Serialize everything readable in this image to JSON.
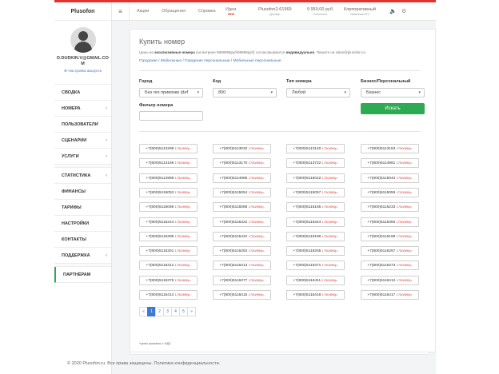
{
  "brand": "Plusofon",
  "user": {
    "email": "D.DUDKIN.V@GMAIL.COM",
    "account_link": "Настройка аккаунта"
  },
  "nav": [
    {
      "label": "СВОДКА",
      "chevron": false
    },
    {
      "label": "НОМЕРА",
      "chevron": true
    },
    {
      "label": "ПОЛЬЗОВАТЕЛИ",
      "chevron": false
    },
    {
      "label": "СЦЕНАРИИ",
      "chevron": true
    },
    {
      "label": "УСЛУГИ",
      "chevron": true
    },
    {
      "label": "СТАТИСТИКА",
      "chevron": true
    },
    {
      "label": "ФИНАНСЫ",
      "chevron": false
    },
    {
      "label": "ТАРИФЫ",
      "chevron": false
    },
    {
      "label": "НАСТРОЙКИ",
      "chevron": false
    },
    {
      "label": "КОНТАКТЫ",
      "chevron": false
    },
    {
      "label": "ПОДДЕРЖКА",
      "chevron": true
    },
    {
      "label": "ПАРТНЁРАМ",
      "chevron": false
    }
  ],
  "topbar": {
    "links": [
      "Акции",
      "Обращения",
      "Справка",
      "Идеи"
    ],
    "new_badge": "NEW",
    "account": {
      "value": "Plusofon2-61969",
      "sub": "Договор"
    },
    "balance": {
      "value": "9 959,00 руб.",
      "sub": "Пополнить"
    },
    "company": {
      "value": "Корпоративный",
      "sub": "Обменная АТС"
    },
    "icons": [
      "sound-icon",
      "settings-icon"
    ]
  },
  "panel": {
    "title": "Купить номер",
    "desc_pre": "Цены на ",
    "desc_bold1": "эксклюзивные номера",
    "desc_mid": " (на витрине 9999999руб/99999руб) согласовываются ",
    "desc_bold2": "индивидуально",
    "desc_post": ". Пишите на sales@plusofon.ru.",
    "crumbs": "Городские / Мобильные / Городские персональные / Мобильные персональные"
  },
  "filters": {
    "city_label": "Город",
    "city_value": "Без гео привязки (def",
    "code_label": "Код",
    "code_value": "800",
    "type_label": "Тип номера",
    "type_value": "Любой",
    "biz_label": "Бизнес/Персональный",
    "biz_value": "Бизнес",
    "filter_label": "Фильтр номера",
    "filter_placeholder": "",
    "search_label": "Искать"
  },
  "price": "1750/890р.",
  "numbers": [
    "+7(800)5112298",
    "+7(800)5113032",
    "+7(800)5113140",
    "+7(800)5113153",
    "+7(800)5113156",
    "+7(800)5113170",
    "+7(800)5113722",
    "+7(800)5114981",
    "+7(800)5114988",
    "+7(800)5114989",
    "+7(800)5115022",
    "+7(800)5115044",
    "+7(800)5115053",
    "+7(800)5115054",
    "+7(800)5115057",
    "+7(800)5115059",
    "+7(800)5115066",
    "+7(800)5115088",
    "+7(800)5115185",
    "+7(800)5115233",
    "+7(800)5115244",
    "+7(800)5115322",
    "+7(800)5115344",
    "+7(800)5115350",
    "+7(800)5115399",
    "+7(800)5115422",
    "+7(800)5116196",
    "+7(800)5116199",
    "+7(800)5116251",
    "+7(800)5116252",
    "+7(800)5116255",
    "+7(800)5116257",
    "+7(800)5116312",
    "+7(800)5116313",
    "+7(800)5116371",
    "+7(800)5116373",
    "+7(800)5116375",
    "+7(800)5116377",
    "+7(800)5116411",
    "+7(800)5116412",
    "+7(800)5116414",
    "+7(800)5116415",
    "+7(800)5116416",
    "+7(800)5116417"
  ],
  "pagination": [
    "«",
    "1",
    "2",
    "3",
    "4",
    "5",
    "»"
  ],
  "pagination_active": "1",
  "footnote": "*цены указаны с НДС",
  "footer": "© 2020 Plusofon.ru. Все права защищены. Политика конфиденциальности."
}
